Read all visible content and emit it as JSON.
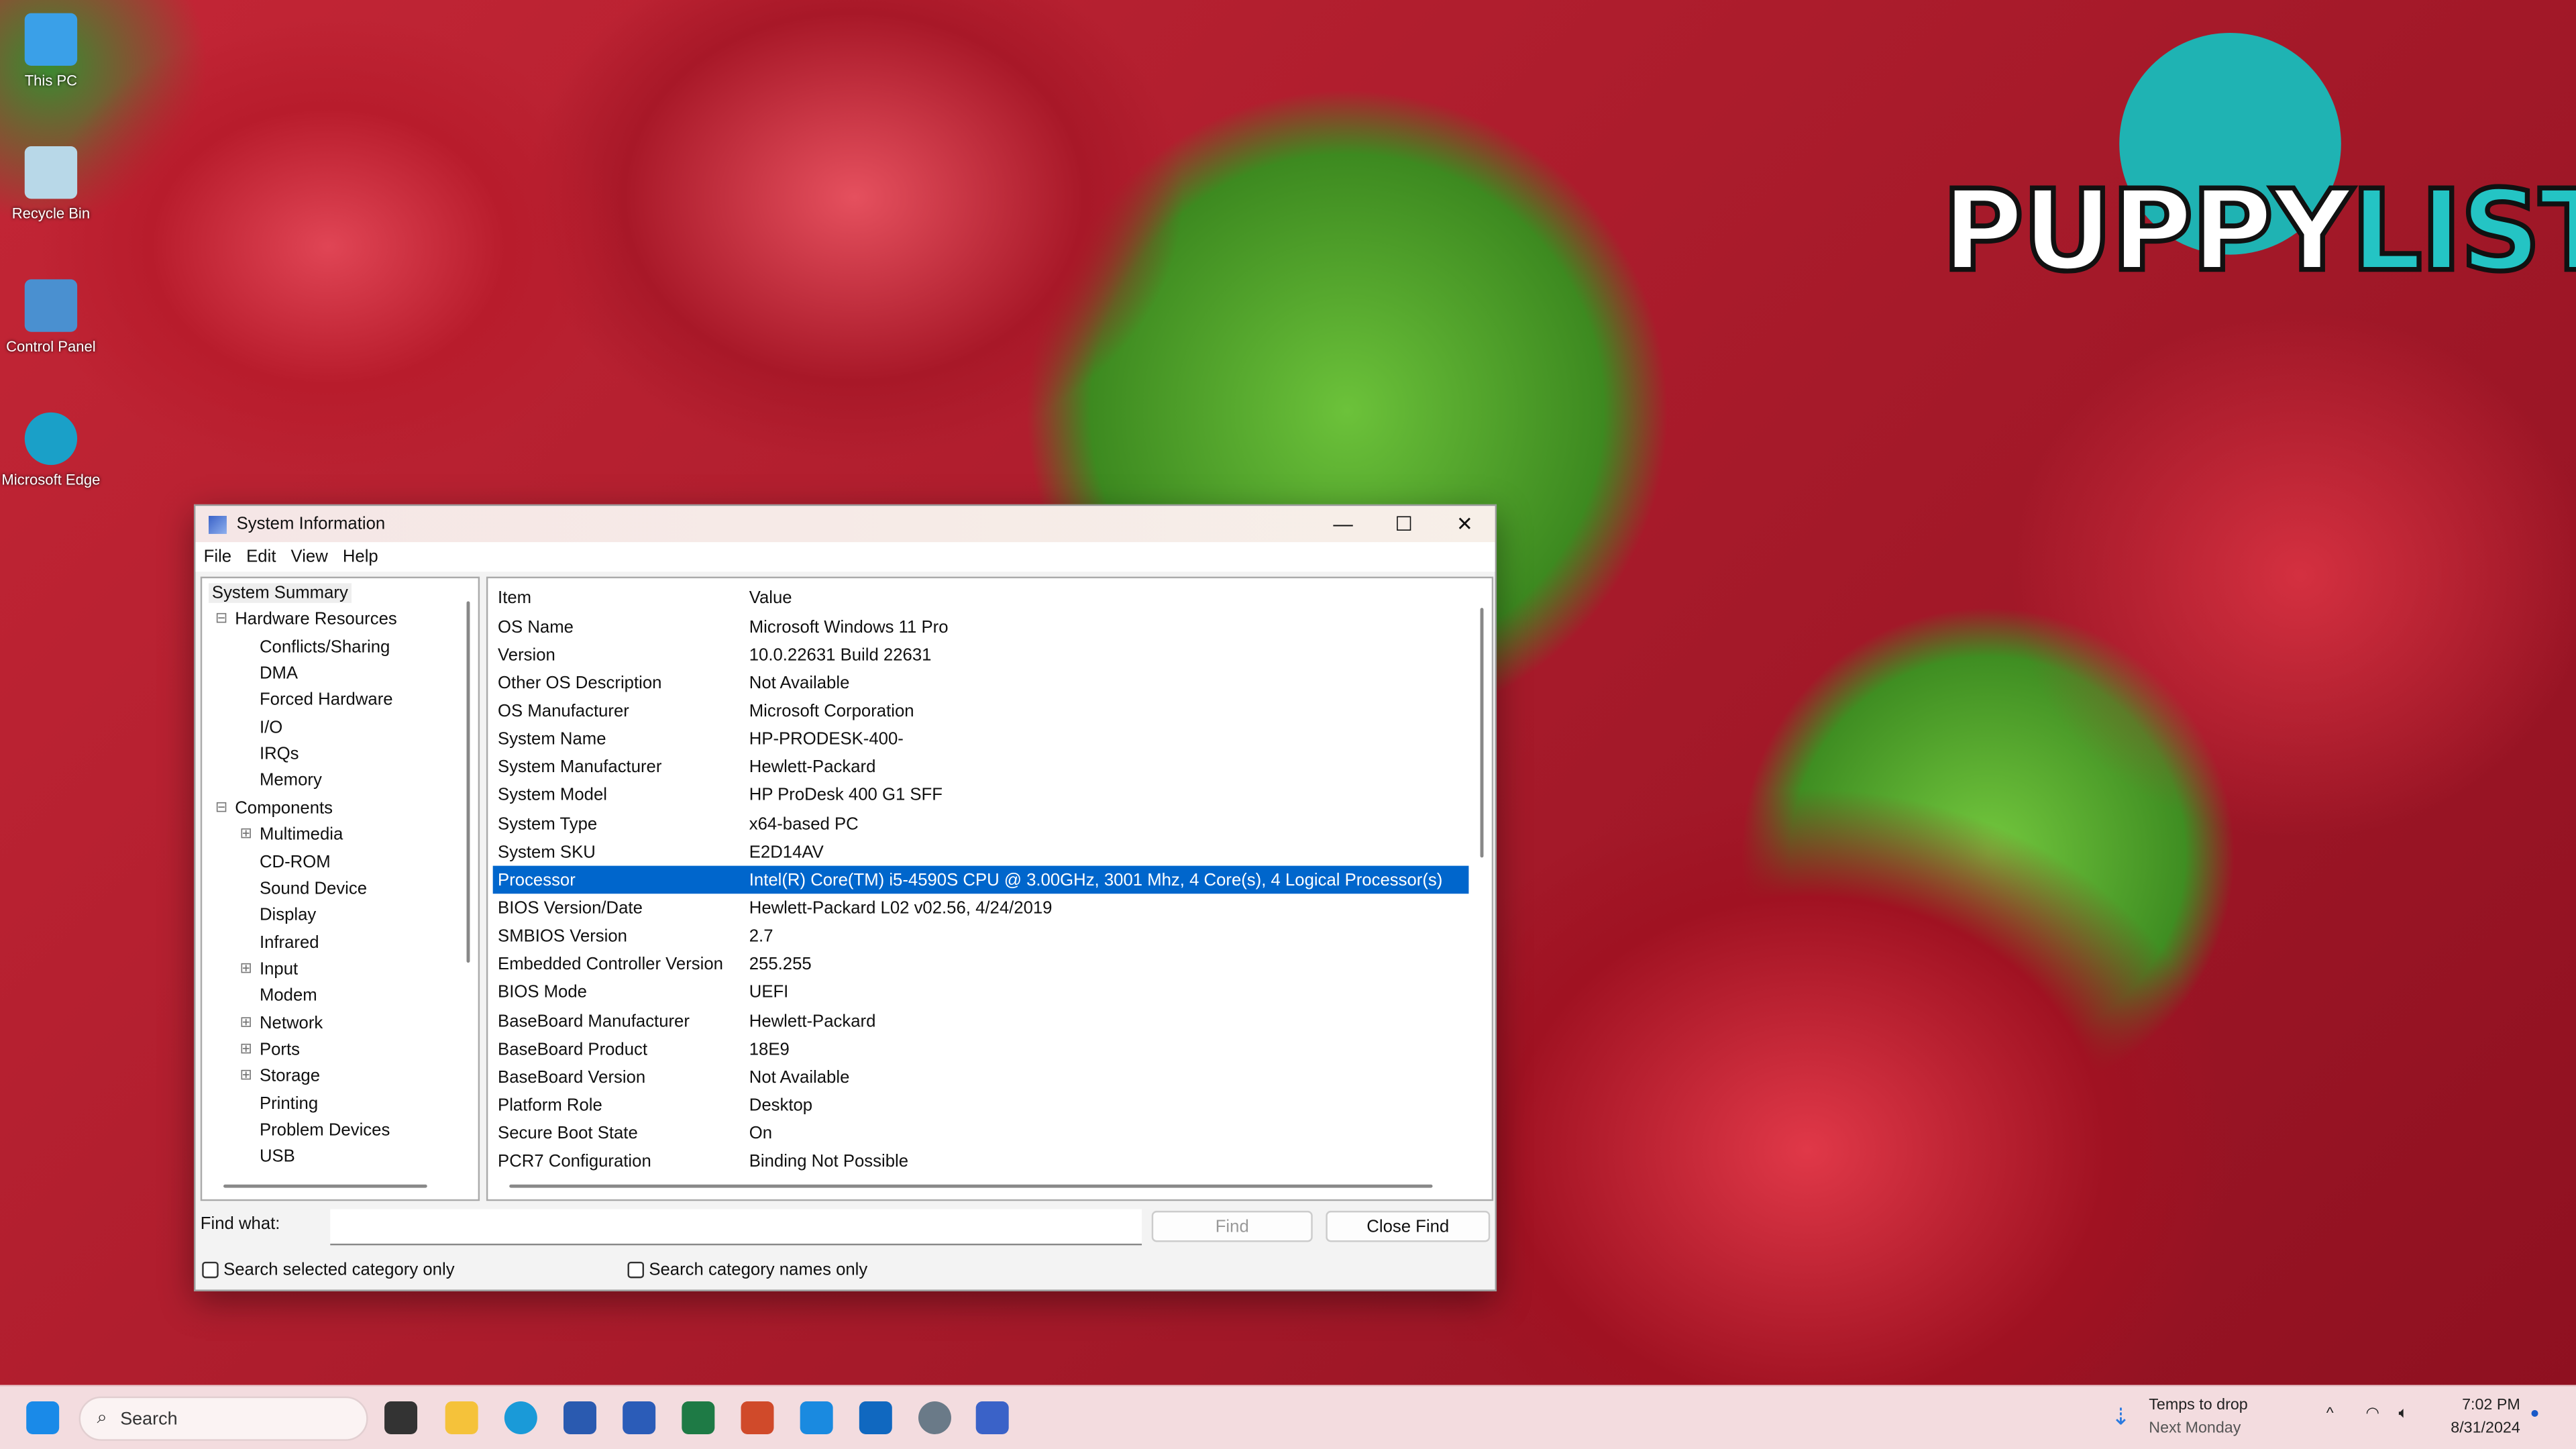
{
  "desktop": {
    "icons": [
      {
        "label": "This PC",
        "icon": "monitor-icon",
        "color": "#3aa0e8"
      },
      {
        "label": "Recycle Bin",
        "icon": "recycle-bin-icon",
        "color": "#b8d8e8"
      },
      {
        "label": "Control Panel",
        "icon": "control-panel-icon",
        "color": "#4a90d0"
      },
      {
        "label": "Microsoft Edge",
        "icon": "edge-icon",
        "color": "#1aa0c8"
      }
    ],
    "logo": {
      "text_a": "PUPPY",
      "text_b": "LIST"
    }
  },
  "window": {
    "title": "System Information",
    "menu": [
      "File",
      "Edit",
      "View",
      "Help"
    ],
    "tree": [
      {
        "label": "System Summary",
        "level": 0,
        "toggle": ""
      },
      {
        "label": "Hardware Resources",
        "level": 1,
        "toggle": "−"
      },
      {
        "label": "Conflicts/Sharing",
        "level": 2,
        "toggle": ""
      },
      {
        "label": "DMA",
        "level": 2,
        "toggle": ""
      },
      {
        "label": "Forced Hardware",
        "level": 2,
        "toggle": ""
      },
      {
        "label": "I/O",
        "level": 2,
        "toggle": ""
      },
      {
        "label": "IRQs",
        "level": 2,
        "toggle": ""
      },
      {
        "label": "Memory",
        "level": 2,
        "toggle": ""
      },
      {
        "label": "Components",
        "level": 1,
        "toggle": "−"
      },
      {
        "label": "Multimedia",
        "level": 2,
        "toggle": "+"
      },
      {
        "label": "CD-ROM",
        "level": 2,
        "toggle": ""
      },
      {
        "label": "Sound Device",
        "level": 2,
        "toggle": ""
      },
      {
        "label": "Display",
        "level": 2,
        "toggle": ""
      },
      {
        "label": "Infrared",
        "level": 2,
        "toggle": ""
      },
      {
        "label": "Input",
        "level": 2,
        "toggle": "+"
      },
      {
        "label": "Modem",
        "level": 2,
        "toggle": ""
      },
      {
        "label": "Network",
        "level": 2,
        "toggle": "+"
      },
      {
        "label": "Ports",
        "level": 2,
        "toggle": "+"
      },
      {
        "label": "Storage",
        "level": 2,
        "toggle": "+"
      },
      {
        "label": "Printing",
        "level": 2,
        "toggle": ""
      },
      {
        "label": "Problem Devices",
        "level": 2,
        "toggle": ""
      },
      {
        "label": "USB",
        "level": 2,
        "toggle": ""
      }
    ],
    "columns": [
      "Item",
      "Value"
    ],
    "rows": [
      [
        "OS Name",
        "Microsoft Windows 11 Pro"
      ],
      [
        "Version",
        "10.0.22631 Build 22631"
      ],
      [
        "Other OS Description",
        "Not Available"
      ],
      [
        "OS Manufacturer",
        "Microsoft Corporation"
      ],
      [
        "System Name",
        "HP-PRODESK-400-"
      ],
      [
        "System Manufacturer",
        "Hewlett-Packard"
      ],
      [
        "System Model",
        "HP ProDesk 400 G1 SFF"
      ],
      [
        "System Type",
        "x64-based PC"
      ],
      [
        "System SKU",
        "E2D14AV"
      ],
      [
        "Processor",
        "Intel(R) Core(TM) i5-4590S CPU @ 3.00GHz, 3001 Mhz, 4 Core(s), 4 Logical Processor(s)"
      ],
      [
        "BIOS Version/Date",
        "Hewlett-Packard L02 v02.56, 4/24/2019"
      ],
      [
        "SMBIOS Version",
        "2.7"
      ],
      [
        "Embedded Controller Version",
        "255.255"
      ],
      [
        "BIOS Mode",
        "UEFI"
      ],
      [
        "BaseBoard Manufacturer",
        "Hewlett-Packard"
      ],
      [
        "BaseBoard Product",
        "18E9"
      ],
      [
        "BaseBoard Version",
        "Not Available"
      ],
      [
        "Platform Role",
        "Desktop"
      ],
      [
        "Secure Boot State",
        "On"
      ],
      [
        "PCR7 Configuration",
        "Binding Not Possible"
      ]
    ],
    "selected_row": 9,
    "selection_color": "#0066cc",
    "find_label": "Find what:",
    "find_value": "",
    "find_button": "Find",
    "close_find_button": "Close Find",
    "checkbox_selected": "Search selected category only",
    "checkbox_names": "Search category names only"
  },
  "taskbar": {
    "search_placeholder": "Search",
    "apps": [
      {
        "icon": "windows-start-icon",
        "color": "#1a8ae8"
      },
      {
        "icon": "task-view-icon",
        "color": "#333333"
      },
      {
        "icon": "file-explorer-icon",
        "color": "#f5c23a"
      },
      {
        "icon": "edge-icon",
        "color": "#1a9ad8"
      },
      {
        "icon": "microsoft-store-icon",
        "color": "#2a5ab0"
      },
      {
        "icon": "word-icon",
        "color": "#2b5cb8"
      },
      {
        "icon": "excel-icon",
        "color": "#1e7a45"
      },
      {
        "icon": "powerpoint-icon",
        "color": "#d04a2a"
      },
      {
        "icon": "outlook-new-icon",
        "color": "#1a8ae0"
      },
      {
        "icon": "outlook-icon",
        "color": "#1068c0"
      },
      {
        "icon": "settings-icon",
        "color": "#6a7a88"
      },
      {
        "icon": "system-information-icon",
        "color": "#3a62c8"
      }
    ],
    "weather_line1": "Temps to drop",
    "weather_line2": "Next Monday",
    "time": "7:02 PM",
    "date": "8/31/2024"
  }
}
